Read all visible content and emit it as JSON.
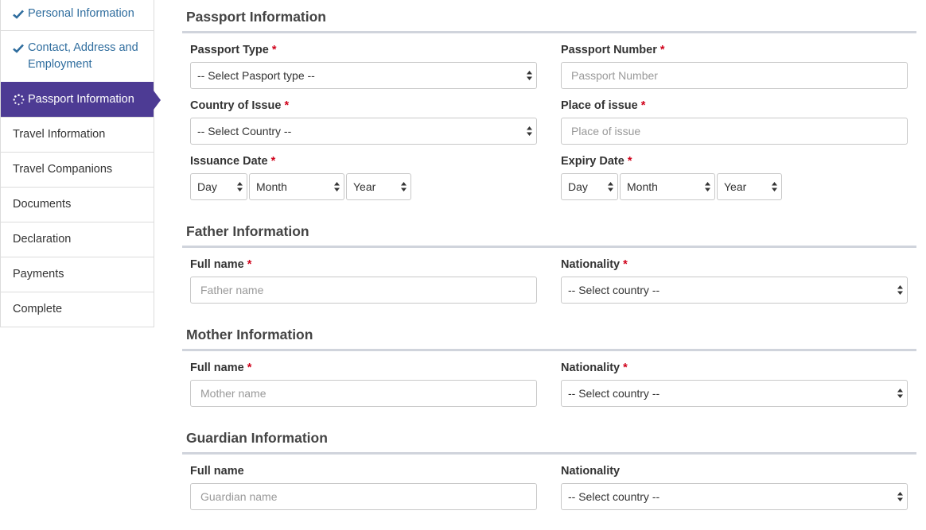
{
  "sidebar": {
    "items": [
      {
        "label": "Personal Information",
        "icon": "check-icon",
        "state": "done"
      },
      {
        "label": "Contact, Address and Employment",
        "icon": "check-icon",
        "state": "done"
      },
      {
        "label": "Passport Information",
        "icon": "spinner-icon",
        "state": "active"
      },
      {
        "label": "Travel Information",
        "state": "pending"
      },
      {
        "label": "Travel Companions",
        "state": "pending"
      },
      {
        "label": "Documents",
        "state": "pending"
      },
      {
        "label": "Declaration",
        "state": "pending"
      },
      {
        "label": "Payments",
        "state": "pending"
      },
      {
        "label": "Complete",
        "state": "pending"
      }
    ],
    "colors": {
      "active_bg": "#4d3b94",
      "done_text": "#2f6d9e"
    }
  },
  "required_mark": "*",
  "passport": {
    "title": "Passport Information",
    "type_label": "Passport Type",
    "type_value": "-- Select Pasport type --",
    "number_label": "Passport Number",
    "number_placeholder": "Passport Number",
    "country_label": "Country of Issue",
    "country_value": "-- Select Country --",
    "place_label": "Place of issue",
    "place_placeholder": "Place of issue",
    "issuance_label": "Issuance Date",
    "expiry_label": "Expiry Date",
    "day": "Day",
    "month": "Month",
    "year": "Year"
  },
  "father": {
    "title": "Father Information",
    "name_label": "Full name",
    "name_placeholder": "Father name",
    "nationality_label": "Nationality",
    "nationality_value": "-- Select country --"
  },
  "mother": {
    "title": "Mother Information",
    "name_label": "Full name",
    "name_placeholder": "Mother name",
    "nationality_label": "Nationality",
    "nationality_value": "-- Select country --"
  },
  "guardian": {
    "title": "Guardian Information",
    "name_label": "Full name",
    "name_placeholder": "Guardian name",
    "nationality_label": "Nationality",
    "nationality_value": "-- Select country --"
  }
}
